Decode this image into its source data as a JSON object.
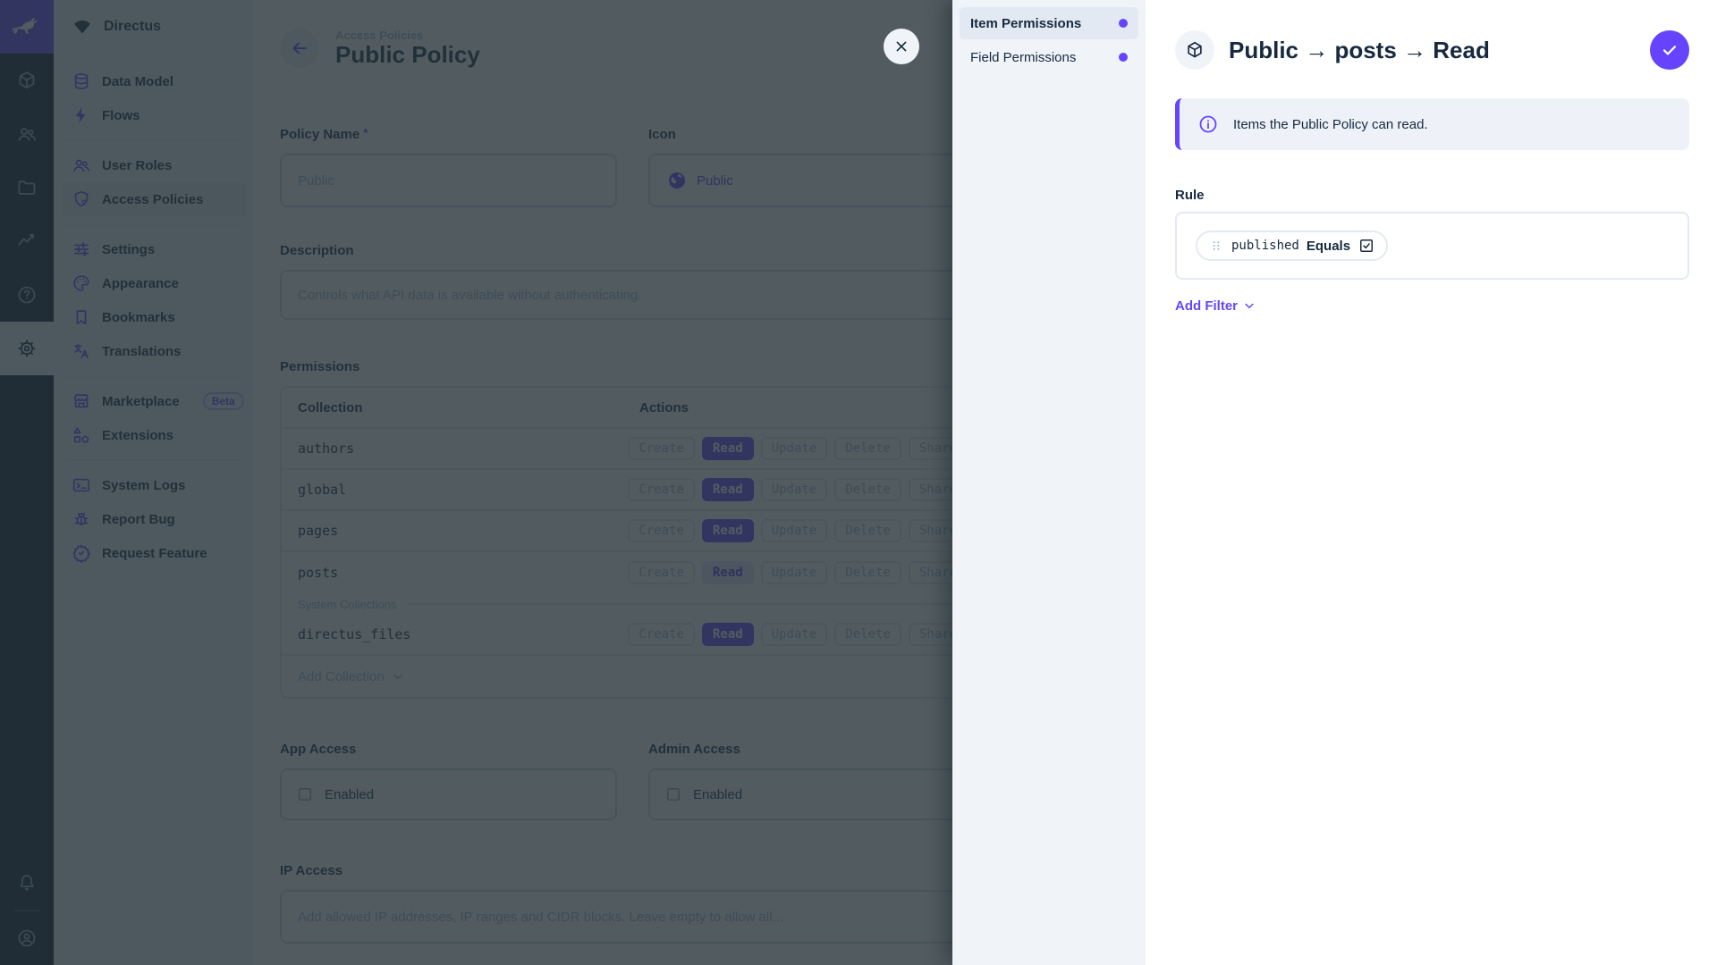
{
  "module_bar": {
    "logo_icon": "rabbit",
    "items": [
      {
        "icon": "cube"
      },
      {
        "icon": "users"
      },
      {
        "icon": "folder"
      },
      {
        "icon": "activity"
      },
      {
        "icon": "help"
      },
      {
        "icon": "gear",
        "active": true
      }
    ],
    "bottom": [
      {
        "icon": "bell"
      },
      {
        "icon": "user-circle"
      }
    ]
  },
  "nav": {
    "project_name": "Directus",
    "project_icon": "signal",
    "groups": [
      {
        "items": [
          {
            "icon": "database",
            "label": "Data Model"
          },
          {
            "icon": "bolt",
            "label": "Flows"
          }
        ]
      },
      {
        "items": [
          {
            "icon": "people",
            "label": "User Roles"
          },
          {
            "icon": "shield",
            "label": "Access Policies",
            "active": true
          }
        ]
      },
      {
        "items": [
          {
            "icon": "sliders",
            "label": "Settings"
          },
          {
            "icon": "palette",
            "label": "Appearance"
          },
          {
            "icon": "bookmark",
            "label": "Bookmarks"
          },
          {
            "icon": "translate",
            "label": "Translations"
          }
        ]
      },
      {
        "items": [
          {
            "icon": "storefront",
            "label": "Marketplace",
            "badge": "Beta"
          },
          {
            "icon": "extension",
            "label": "Extensions"
          }
        ]
      },
      {
        "items": [
          {
            "icon": "terminal",
            "label": "System Logs"
          },
          {
            "icon": "bug",
            "label": "Report Bug"
          },
          {
            "icon": "sparkle",
            "label": "Request Feature"
          }
        ]
      }
    ]
  },
  "main": {
    "breadcrumb": "Access Policies",
    "title": "Public Policy",
    "form": {
      "policy_name": {
        "label": "Policy Name",
        "required_marker": "*",
        "value": "Public"
      },
      "icon": {
        "label": "Icon",
        "value": "Public",
        "icon": "globe"
      },
      "description": {
        "label": "Description",
        "placeholder": "Controls what API data is available without authenticating."
      }
    },
    "permissions": {
      "label": "Permissions",
      "columns": [
        "Collection",
        "Actions"
      ],
      "action_labels": [
        "Create",
        "Read",
        "Update",
        "Delete",
        "Share"
      ],
      "rows": [
        {
          "collection": "authors",
          "states": [
            "none",
            "full",
            "none",
            "none",
            "none"
          ]
        },
        {
          "collection": "global",
          "states": [
            "none",
            "full",
            "none",
            "none",
            "none"
          ]
        },
        {
          "collection": "pages",
          "states": [
            "none",
            "full",
            "none",
            "none",
            "none"
          ]
        },
        {
          "collection": "posts",
          "states": [
            "none",
            "custom",
            "none",
            "none",
            "none"
          ]
        }
      ],
      "system_divider": "System Collections",
      "system_rows": [
        {
          "collection": "directus_files",
          "states": [
            "none",
            "full",
            "none",
            "none",
            "none"
          ]
        }
      ],
      "add_collection": "Add Collection"
    },
    "app_access": {
      "label": "App Access",
      "checkbox_label": "Enabled",
      "checked": false
    },
    "admin_access": {
      "label": "Admin Access",
      "checkbox_label": "Enabled",
      "checked": false
    },
    "ip_access": {
      "label": "IP Access",
      "placeholder": "Add allowed IP addresses, IP ranges and CIDR blocks. Leave empty to allow all..."
    }
  },
  "drawer": {
    "tabs": [
      {
        "label": "Item Permissions",
        "active": true
      },
      {
        "label": "Field Permissions"
      }
    ],
    "title": "Public → posts → Read",
    "title_icon": "cube",
    "banner": {
      "icon": "info",
      "text": "Items the Public Policy can read."
    },
    "rule": {
      "label": "Rule",
      "filter": {
        "field": "published",
        "operator": "Equals",
        "value_icon": "checkbox-checked"
      },
      "add_filter_label": "Add Filter"
    }
  },
  "colors": {
    "primary": "#6644FF",
    "navy": "#172940",
    "subdued": "#A2B5CD",
    "overlay": "rgba(38,50,56,0.8)"
  }
}
